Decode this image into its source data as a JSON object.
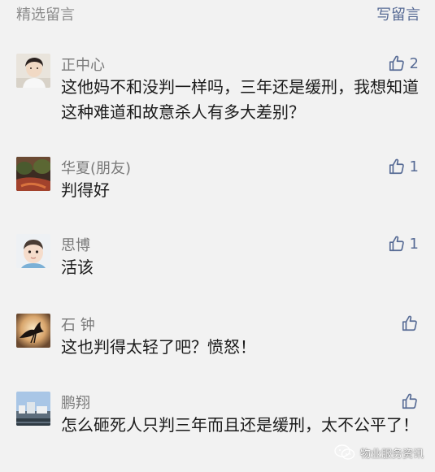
{
  "header": {
    "title": "精选留言",
    "write_label": "写留言"
  },
  "comments": [
    {
      "name": "正中心",
      "text": "这他妈不和没判一样吗，三年还是缓刑，我想知道这种难道和故意杀人有多大差别？",
      "likes": "2"
    },
    {
      "name": "华夏(朋友)",
      "text": "判得好",
      "likes": "1"
    },
    {
      "name": "思博",
      "text": "活该",
      "likes": "1"
    },
    {
      "name": "石 钟",
      "text": "这也判得太轻了吧？愤怒！",
      "likes": ""
    },
    {
      "name": "鹏翔",
      "text": "怎么砸死人只判三年而且还是缓刑，太不公平了！",
      "likes": ""
    }
  ],
  "watermark": {
    "text": "物业服务资讯",
    "icon": "wechat-icon"
  },
  "colors": {
    "link": "#576b95",
    "nickname": "#7a7a7a",
    "background": "#f2f2f2"
  }
}
